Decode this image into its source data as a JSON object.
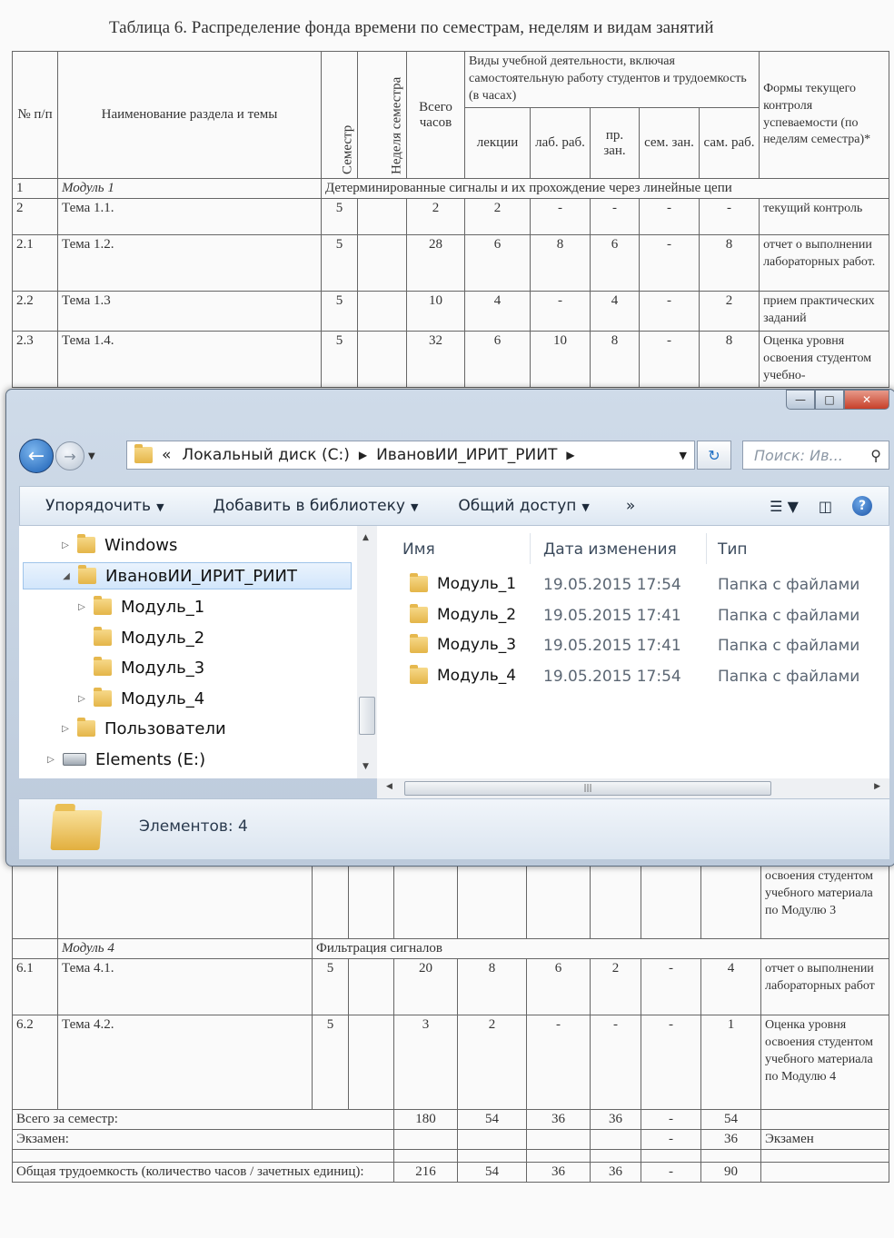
{
  "document": {
    "title": "Таблица 6. Распределение фонда времени по семестрам, неделям и видам занятий",
    "headers": {
      "num": "№ п/п",
      "name": "Наименование раздела и темы",
      "semester": "Семестр",
      "week": "Неделя семестра",
      "total": "Всего часов",
      "kinds": "Виды учебной деятельности, включая самостоятельную работу студентов и трудоемкость (в часах)",
      "lectures": "лекции",
      "lab": "лаб. раб.",
      "pract": "пр. зан.",
      "sem": "сем. зан.",
      "self": "сам. раб.",
      "forms": "Формы текущего контроля успеваемости (по неделям семестра)*"
    },
    "module1": {
      "num": "1",
      "name": "Модуль 1",
      "title": "Детерминированные сигналы и их прохождение через линейные цепи"
    },
    "rows_top": [
      {
        "num": "2",
        "name": "Тема 1.1.",
        "sem": "5",
        "total": "2",
        "lec": "2",
        "lab": "-",
        "pr": "-",
        "sz": "-",
        "sr": "-",
        "form": "текущий контроль"
      },
      {
        "num": "2.1",
        "name": "Тема 1.2.",
        "sem": "5",
        "total": "28",
        "lec": "6",
        "lab": "8",
        "pr": "6",
        "sz": "-",
        "sr": "8",
        "form": "отчет о выполнении лабораторных работ."
      },
      {
        "num": "2.2",
        "name": "Тема 1.3",
        "sem": "5",
        "total": "10",
        "lec": "4",
        "lab": "-",
        "pr": "4",
        "sz": "-",
        "sr": "2",
        "form": "прием практических заданий"
      },
      {
        "num": "2.3",
        "name": "Тема 1.4.",
        "sem": "5",
        "total": "32",
        "lec": "6",
        "lab": "10",
        "pr": "8",
        "sz": "-",
        "sr": "8",
        "form": "Оценка уровня освоения студентом учебно-"
      }
    ],
    "partial_form": "освоения студентом учебного материала по Модулю 3",
    "module4": {
      "name": "Модуль 4",
      "title": "Фильтрация сигналов"
    },
    "rows_bottom": [
      {
        "num": "6.1",
        "name": "Тема 4.1.",
        "sem": "5",
        "total": "20",
        "lec": "8",
        "lab": "6",
        "pr": "2",
        "sz": "-",
        "sr": "4",
        "form": "отчет о выполнении лабораторных работ"
      },
      {
        "num": "6.2",
        "name": "Тема 4.2.",
        "sem": "5",
        "total": "3",
        "lec": "2",
        "lab": "-",
        "pr": "-",
        "sz": "-",
        "sr": "1",
        "form": "Оценка уровня освоения студентом учебного материала по Модулю 4"
      }
    ],
    "total_semester": {
      "label": "Всего за семестр:",
      "total": "180",
      "lec": "54",
      "lab": "36",
      "pr": "36",
      "sz": "-",
      "sr": "54"
    },
    "exam": {
      "label": "Экзамен:",
      "sz": "-",
      "sr": "36",
      "form": "Экзамен"
    },
    "overall": {
      "label": "Общая трудоемкость (количество часов / зачетных единиц):",
      "total": "216",
      "lec": "54",
      "lab": "36",
      "pr": "36",
      "sz": "-",
      "sr": "90"
    }
  },
  "explorer": {
    "address": {
      "prefix": "«",
      "crumb1": "Локальный диск (C:)",
      "crumb2": "ИвановИИ_ИРИТ_РИИТ"
    },
    "search_placeholder": "Поиск: Ив...",
    "toolbar": {
      "organize": "Упорядочить",
      "add_library": "Добавить в библиотеку",
      "share": "Общий доступ",
      "more": "»"
    },
    "tree": [
      {
        "label": "Windows"
      },
      {
        "label": "ИвановИИ_ИРИТ_РИИТ"
      },
      {
        "label": "Модуль_1"
      },
      {
        "label": "Модуль_2"
      },
      {
        "label": "Модуль_3"
      },
      {
        "label": "Модуль_4"
      },
      {
        "label": "Пользователи"
      },
      {
        "label": "Elements (E:)"
      }
    ],
    "columns": {
      "name": "Имя",
      "date": "Дата изменения",
      "type": "Тип"
    },
    "files": [
      {
        "name": "Модуль_1",
        "date": "19.05.2015 17:54",
        "type": "Папка с файлами"
      },
      {
        "name": "Модуль_2",
        "date": "19.05.2015 17:41",
        "type": "Папка с файлами"
      },
      {
        "name": "Модуль_3",
        "date": "19.05.2015 17:41",
        "type": "Папка с файлами"
      },
      {
        "name": "Модуль_4",
        "date": "19.05.2015 17:54",
        "type": "Папка с файлами"
      }
    ],
    "status": "Элементов: 4"
  }
}
